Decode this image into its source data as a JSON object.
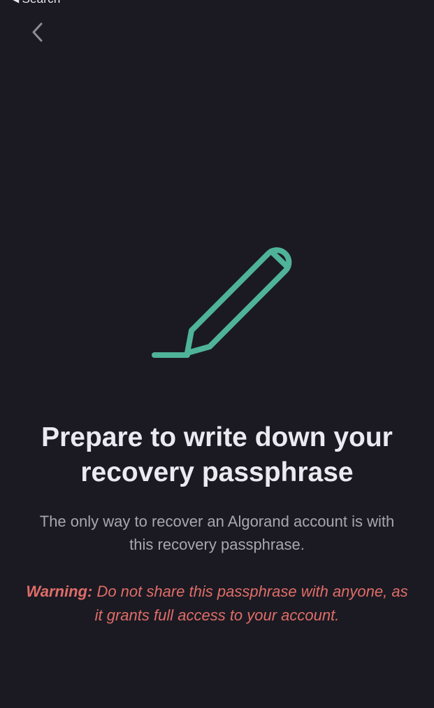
{
  "status_bar": {
    "back_app_label": "Search",
    "back_glyph": "◀"
  },
  "nav": {
    "back_icon": "chevron-left-icon"
  },
  "illustration": {
    "icon": "pencil-icon",
    "color": "#4fb39a"
  },
  "content": {
    "title": "Prepare to write down your recovery passphrase",
    "description": "The only way to recover an Algorand account is with this recovery passphrase.",
    "warning_label": "Warning:",
    "warning_text": "Do not share this passphrase with anyone, as it grants full access to your account."
  },
  "colors": {
    "background": "#1b1a22",
    "title": "#eceaf1",
    "description": "#a8a6b2",
    "warning": "#e06d68",
    "accent": "#4fb39a"
  }
}
